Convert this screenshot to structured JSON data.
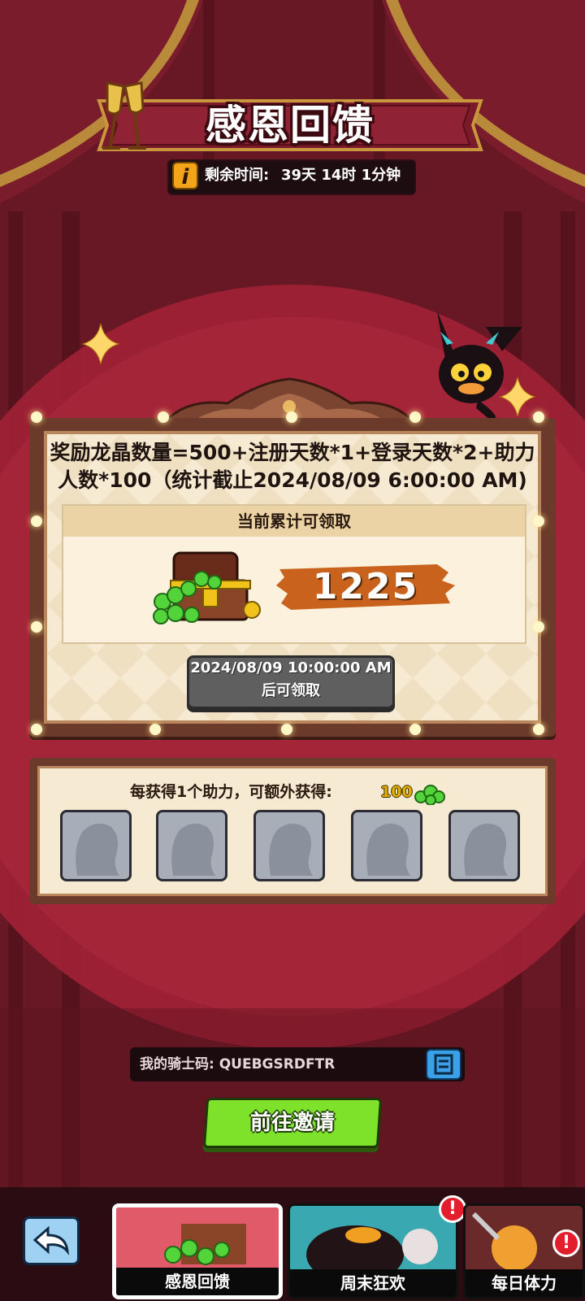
{
  "header": {
    "title": "感恩回馈",
    "timer_label": "剩余时间:",
    "timer_value": "39天 14时 1分钟",
    "info_icon": "i"
  },
  "reward": {
    "formula": "奖励龙晶数量=500+注册天数*1+登录天数*2+助力人数*100（统计截止2024/08/09 6:00:00 AM)",
    "panel_header": "当前累计可领取",
    "amount": "1225",
    "claim_label": "2024/08/09 10:00:00 AM后可领取"
  },
  "help": {
    "line": "每获得1个助力，可额外获得:",
    "value": "100",
    "slots": [
      "",
      "",
      "",
      "",
      ""
    ]
  },
  "invite": {
    "code_label": "我的骑士码: QUEBGSRDFTR",
    "copy_icon": "copy-icon",
    "button_label": "前往邀请"
  },
  "tabs": [
    {
      "label": "感恩回馈",
      "active": true,
      "alert": false
    },
    {
      "label": "周末狂欢",
      "active": false,
      "alert": true
    },
    {
      "label": "每日体力",
      "active": false,
      "alert": true
    }
  ],
  "alert_mark": "!",
  "colors": {
    "curtain": "#7a1a2a",
    "board_frame": "#6b3a2a",
    "parchment": "#f6ead2",
    "accent_orange": "#d4731e",
    "invite_green": "#7ee22a",
    "copy_blue": "#3aa0e8"
  }
}
